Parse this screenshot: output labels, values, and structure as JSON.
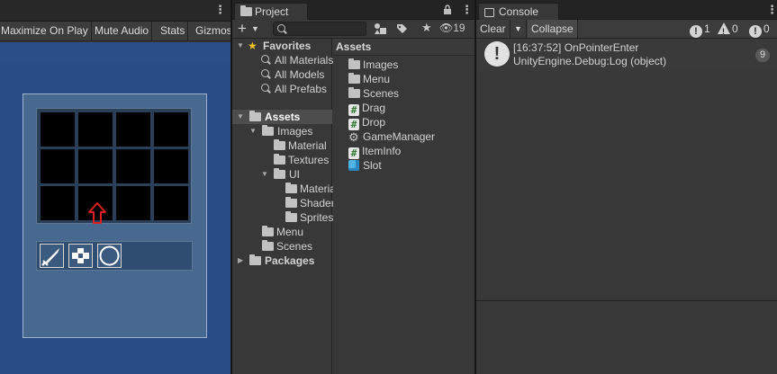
{
  "game": {
    "toolbar": [
      "Maximize On Play",
      "Mute Audio",
      "Stats",
      "Gizmos"
    ],
    "kebab": "⋮"
  },
  "project": {
    "tab_label": "Project",
    "hidden_count": "19",
    "tree": {
      "favorites": "Favorites",
      "favorite_items": [
        "All Materials",
        "All Models",
        "All Prefabs"
      ],
      "assets": "Assets",
      "images": "Images",
      "material": "Material",
      "textures": "Textures",
      "ui": "UI",
      "ui_children": [
        "Materials",
        "Shaders",
        "Sprites"
      ],
      "menu": "Menu",
      "scenes": "Scenes",
      "packages": "Packages"
    },
    "assets_header": "Assets",
    "asset_items": [
      {
        "label": "Images",
        "icon": "folder-icon"
      },
      {
        "label": "Menu",
        "icon": "folder-icon"
      },
      {
        "label": "Scenes",
        "icon": "folder-icon"
      },
      {
        "label": "Drag",
        "icon": "csharp-script-icon"
      },
      {
        "label": "Drop",
        "icon": "csharp-script-icon"
      },
      {
        "label": "GameManager",
        "icon": "gear-icon"
      },
      {
        "label": "ItemInfo",
        "icon": "csharp-script-icon"
      },
      {
        "label": "Slot",
        "icon": "prefab-cube-icon"
      }
    ]
  },
  "console": {
    "tab_label": "Console",
    "clear": "Clear",
    "collapse": "Collapse",
    "log_count": "1",
    "warning_count": "0",
    "error_count": "0",
    "log_line1": "[16:37:52] OnPointerEnter",
    "log_line2": "UnityEngine.Debug:Log (object)",
    "collapsed_count": "9"
  },
  "colors": {
    "game_background": "#2a4c86",
    "inventory_panel": "#47698f",
    "slot": "#000000",
    "cursor_arrow": "#e02020",
    "editor_background": "#383838"
  }
}
